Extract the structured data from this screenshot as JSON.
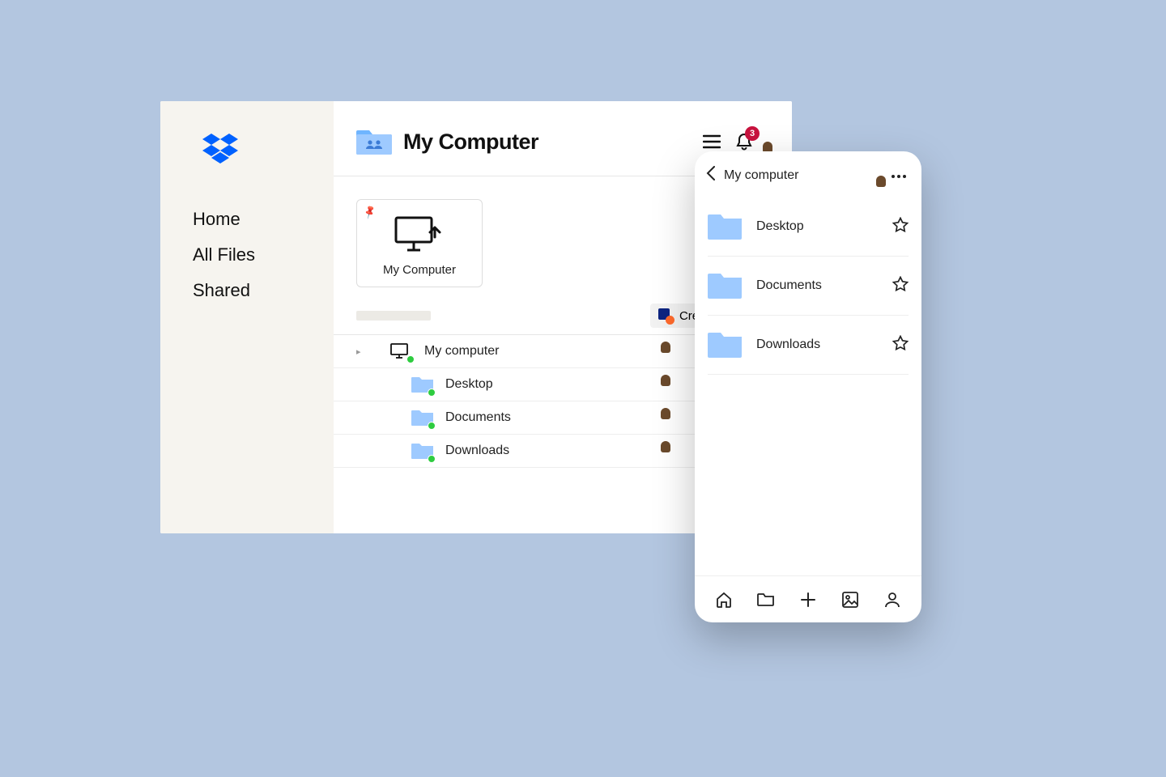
{
  "sidebar": {
    "items": [
      "Home",
      "All Files",
      "Shared"
    ]
  },
  "header": {
    "title": "My Computer",
    "badge_count": "3"
  },
  "card": {
    "label": "My Computer"
  },
  "toolbar": {
    "create_label": "Create"
  },
  "rows": [
    {
      "name": "My computer",
      "indent": 0,
      "icon": "computer"
    },
    {
      "name": "Desktop",
      "indent": 1,
      "icon": "folder"
    },
    {
      "name": "Documents",
      "indent": 1,
      "icon": "folder"
    },
    {
      "name": "Downloads",
      "indent": 1,
      "icon": "folder"
    }
  ],
  "mobile": {
    "title": "My computer",
    "items": [
      "Desktop",
      "Documents",
      "Downloads"
    ]
  }
}
